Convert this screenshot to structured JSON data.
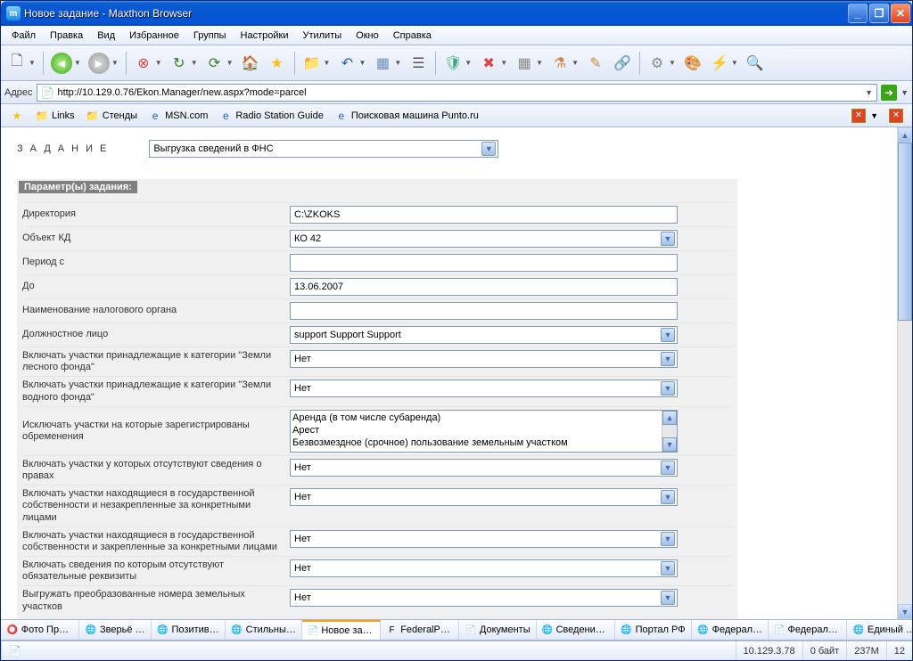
{
  "window": {
    "title": "Новое задание - Maxthon Browser"
  },
  "menu": [
    "Файл",
    "Правка",
    "Вид",
    "Избранное",
    "Группы",
    "Настройки",
    "Утилиты",
    "Окно",
    "Справка"
  ],
  "address": {
    "label": "Адрес",
    "url": "http://10.129.0.76/Ekon.Manager/new.aspx?mode=parcel"
  },
  "bookmarks": [
    "Links",
    "Стенды",
    "MSN.com",
    "Radio Station Guide",
    "Поисковая машина Punto.ru"
  ],
  "task": {
    "label": "ЗАДАНИЕ",
    "value": "Выгрузка сведений в ФНС"
  },
  "section": "Параметр(ы) задания:",
  "form": {
    "dir_label": "Директория",
    "dir_value": "C:\\ZKOKS",
    "obj_label": "Объект КД",
    "obj_value": "КО 42",
    "period_from_label": "Период с",
    "period_from_value": "",
    "period_to_label": "До",
    "period_to_value": "13.06.2007",
    "tax_label": "Наименование налогового органа",
    "tax_value": "",
    "official_label": "Должностное лицо",
    "official_value": "support Support Support",
    "forest_label": "Включать участки принадлежащие к категории \"Земли лесного фонда\"",
    "forest_value": "Нет",
    "water_label": "Включать участки принадлежащие к категории \"Земли водного фонда\"",
    "water_value": "Нет",
    "exclude_label": "Исключать участки на которые зарегистрированы обременения",
    "exclude_items": [
      "Аренда (в том числе субаренда)",
      "Арест",
      "Безвозмездное (срочное) пользование земельным участком"
    ],
    "norights_label": "Включать участки у которых отсутствуют сведения о правах",
    "norights_value": "Нет",
    "gov1_label": "Включать участки находящиеся в государственной собственности и незакрепленные за конкретными лицами",
    "gov1_value": "Нет",
    "gov2_label": "Включать участки находящиеся в государственной собственности и закрепленные за конкретными лицами",
    "gov2_value": "Нет",
    "req_label": "Включать сведения по которым отсутствуют обязательные реквизиты",
    "req_value": "Нет",
    "conv_label": "Выгружать преобразованные номера земельных участков",
    "conv_value": "Нет"
  },
  "tabs": [
    {
      "label": "Фото При…",
      "active": false,
      "icon": "⭕"
    },
    {
      "label": "Зверьё …",
      "active": false,
      "icon": "🌐"
    },
    {
      "label": "Позитив…",
      "active": false,
      "icon": "🌐"
    },
    {
      "label": "Стильны…",
      "active": false,
      "icon": "🌐"
    },
    {
      "label": "Новое задание",
      "active": true,
      "icon": "📄"
    },
    {
      "label": "FederalPo…",
      "active": false,
      "icon": "F"
    },
    {
      "label": "Документы",
      "active": false,
      "icon": "📄"
    },
    {
      "label": "Сведения …",
      "active": false,
      "icon": "🌐"
    },
    {
      "label": "Портал РФ",
      "active": false,
      "icon": "🌐"
    },
    {
      "label": "Федерал…",
      "active": false,
      "icon": "🌐"
    },
    {
      "label": "Федерально…",
      "active": false,
      "icon": "📄"
    },
    {
      "label": "Единый к…",
      "active": false,
      "icon": "🌐"
    }
  ],
  "status": {
    "ip": "10.129.3.78",
    "bytes": "0 байт",
    "mem": "237M",
    "tabs": "12"
  }
}
